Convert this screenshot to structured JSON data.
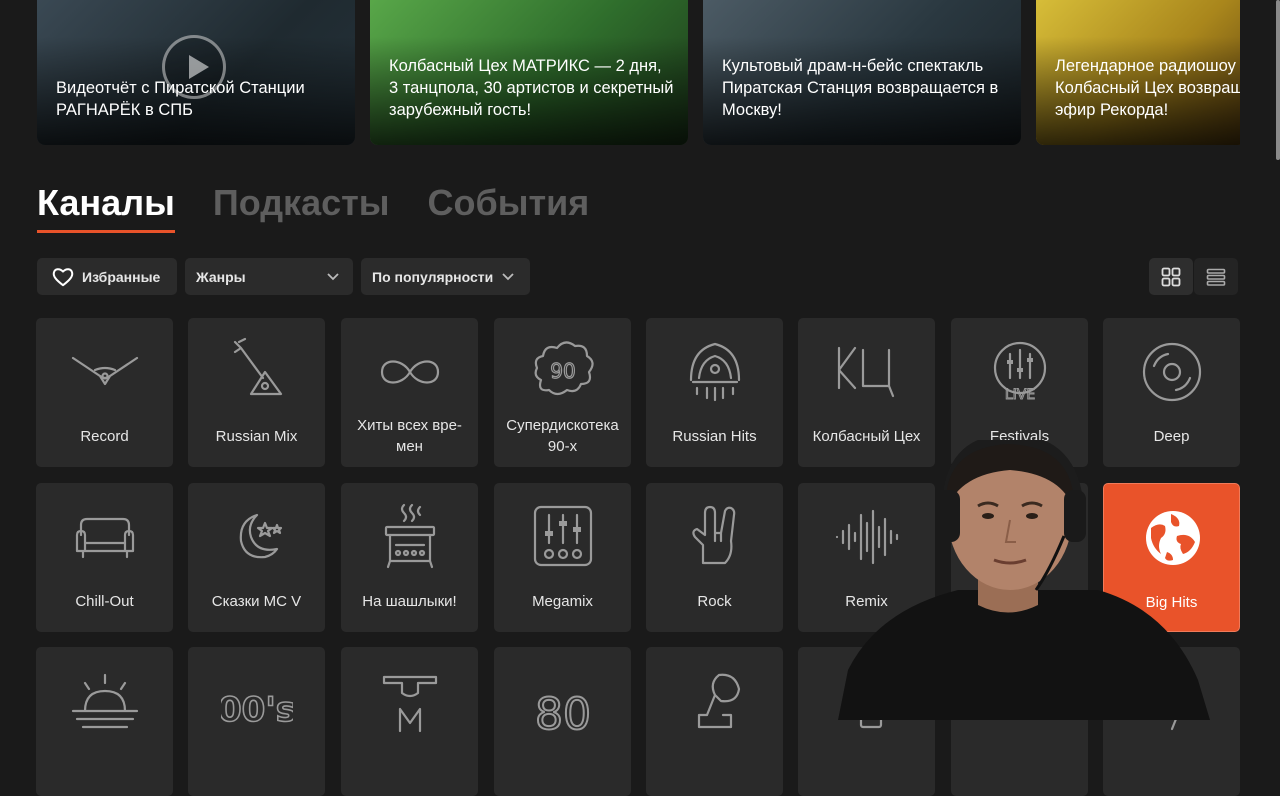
{
  "news": [
    {
      "text": "Видеотчёт с Пиратской Станции РАГНАРЁК в СПБ",
      "color": "#2c3a44"
    },
    {
      "text": "Колбасный Цех МАТРИКС — 2 дня, 3 танцпола, 30 артистов и секретный зарубежный гость!",
      "color": "#3f8a3a"
    },
    {
      "text": "Культовый драм-н-бейс спектакль Пиратская Станция возвращается в Москву!",
      "color": "#3a4a55"
    },
    {
      "text": "Легендарное радиошоу Колбасный Цех возвращается в эфир Рекорда!",
      "color": "#b59a22"
    }
  ],
  "tabs": [
    "Каналы",
    "Подкасты",
    "События"
  ],
  "filters": {
    "favorites": "Избранные",
    "genres": "Жанры",
    "sort": "По популярности"
  },
  "accent": "#e9532a",
  "channels": [
    {
      "label": "Record",
      "icon": "record-logo-icon"
    },
    {
      "label": "Russian Mix",
      "icon": "balalaika-icon"
    },
    {
      "label": "Хиты всех вре-мен",
      "icon": "infinity-icon"
    },
    {
      "label": "Супердискотека 90-х",
      "icon": "cloud-90-icon"
    },
    {
      "label": "Russian Hits",
      "icon": "kokoshnik-icon"
    },
    {
      "label": "Колбасный Цех",
      "icon": "kc-logo-icon"
    },
    {
      "label": "Festivals",
      "icon": "live-icon"
    },
    {
      "label": "Deep",
      "icon": "vinyl-icon"
    },
    {
      "label": "Chill-Out",
      "icon": "sofa-icon"
    },
    {
      "label": "Сказки MC V",
      "icon": "moon-stars-icon"
    },
    {
      "label": "На шашлыки!",
      "icon": "grill-icon"
    },
    {
      "label": "Megamix",
      "icon": "mixer-icon"
    },
    {
      "label": "Rock",
      "icon": "rock-hand-icon"
    },
    {
      "label": "Remix",
      "icon": "waveform-icon"
    },
    {
      "label": "",
      "icon": "hidden-icon"
    },
    {
      "label": "Big Hits",
      "icon": "globe-icon"
    },
    {
      "label": "",
      "icon": "sunrise-icon"
    },
    {
      "label": "",
      "icon": "00s-icon"
    },
    {
      "label": "",
      "icon": "m-icon"
    },
    {
      "label": "",
      "icon": "80-icon"
    },
    {
      "label": "",
      "icon": "gramophone-icon"
    },
    {
      "label": "",
      "icon": "square-icon"
    },
    {
      "label": "",
      "icon": "hidden-icon"
    },
    {
      "label": "",
      "icon": "bolt-icon"
    }
  ]
}
